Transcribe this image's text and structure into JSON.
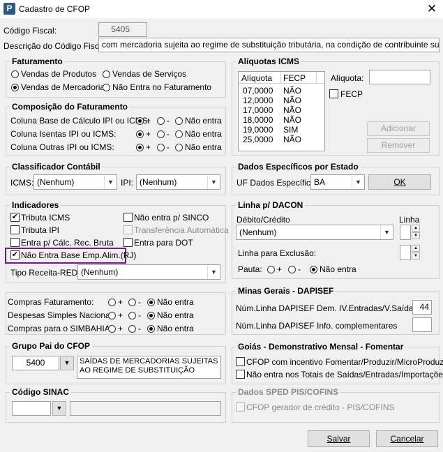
{
  "window": {
    "title": "Cadastro de CFOP",
    "app_icon_letter": "P"
  },
  "codigo_fiscal": {
    "label": "Código Fiscal:",
    "value": "5405"
  },
  "descricao": {
    "label": "Descrição do Código Fiscal:",
    "value": "com mercadoria sujeita ao regime de substituição tributária, na condição de contribuinte substituído"
  },
  "faturamento": {
    "title": "Faturamento",
    "opt1": "Vendas de Produtos",
    "opt2": "Vendas de Serviços",
    "opt3": "Vendas de Mercadorias",
    "opt4": "Não Entra no Faturamento"
  },
  "composicao": {
    "title": "Composição do Faturamento",
    "row1": "Coluna Base de Cálculo IPI ou ICMS:",
    "row2": "Coluna Isentas IPI ou ICMS:",
    "row3": "Coluna Outras IPI ou ICMS:",
    "plus": "+",
    "minus": "-",
    "nao_entra": "Não entra"
  },
  "classificador": {
    "title": "Classificador Contábil",
    "icms_label": "ICMS:",
    "icms_value": "(Nenhum)",
    "ipi_label": "IPI:",
    "ipi_value": "(Nenhum)"
  },
  "indicadores": {
    "title": "Indicadores",
    "tributa_icms": "Tributa ICMS",
    "tributa_ipi": "Tributa IPI",
    "entra_calc": "Entra p/ Cálc. Rec. Bruta",
    "nao_entra_base": "Não Entra Base Emp.Alim.(RJ)",
    "nao_entra_sinco": "Não entra p/ SINCO",
    "transferencia": "Transferência Automática",
    "entra_dot": "Entra para DOT",
    "tipo_receita_label": "Tipo Receita-REDF:",
    "tipo_receita_value": "(Nenhum)"
  },
  "compras": {
    "row1": "Compras Faturamento:",
    "row2": "Despesas Simples Nacional:",
    "row3": "Compras para o SIMBAHIA:",
    "plus": "+",
    "minus": "-",
    "nao_entra": "Não entra"
  },
  "grupo_pai": {
    "title": "Grupo Pai do CFOP",
    "code": "5400",
    "desc": "SAÍDAS DE MERCADORIAS SUJEITAS AO REGIME DE SUBSTITUIÇÃO"
  },
  "sinac": {
    "title": "Código SINAC"
  },
  "aliquotas": {
    "title": "Alíquotas ICMS",
    "col1": "Alíquota",
    "col2": "FECP",
    "rows": [
      [
        "07,0000",
        "NÃO"
      ],
      [
        "12,0000",
        "NÃO"
      ],
      [
        "17,0000",
        "NÃO"
      ],
      [
        "18,0000",
        "NÃO"
      ],
      [
        "19,0000",
        "SIM"
      ],
      [
        "25,0000",
        "NÃO"
      ]
    ],
    "aliquota_label": "Alíquota:",
    "fecp_label": "FECP",
    "adicionar": "Adicionar",
    "remover": "Remover"
  },
  "dados_estado": {
    "title": "Dados Específicos por Estado",
    "uf_label": "UF Dados Específicos:",
    "uf_value": "BA",
    "ok": "OK"
  },
  "dacon": {
    "title": "Linha p/ DACON",
    "debito_label": "Débito/Crédito",
    "linha_label": "Linha",
    "debito_value": "(Nenhum)",
    "exclusao_label": "Linha para Exclusão:",
    "pauta_label": "Pauta:",
    "plus": "+",
    "minus": "-",
    "nao_entra": "Não entra"
  },
  "minas": {
    "title": "Minas Gerais - DAPISEF",
    "row1": "Núm.Linha DAPISEF Dem. IV.Entradas/V.Saídas",
    "row1_value": "44",
    "row2": "Núm.Linha DAPISEF Info. complementares"
  },
  "goias": {
    "title": "Goiás - Demonstrativo Mensal - Fomentar",
    "opt1": "CFOP com incentivo  Fomentar/Produzir/MicroProduzir",
    "opt2": "Não entra nos Totais de  Saídas/Entradas/Importações"
  },
  "sped": {
    "title": "Dados SPED PIS/COFINS",
    "opt1": "CFOP gerador de crédito - PIS/COFINS"
  },
  "buttons": {
    "salvar": "Salvar",
    "cancelar": "Cancelar"
  }
}
